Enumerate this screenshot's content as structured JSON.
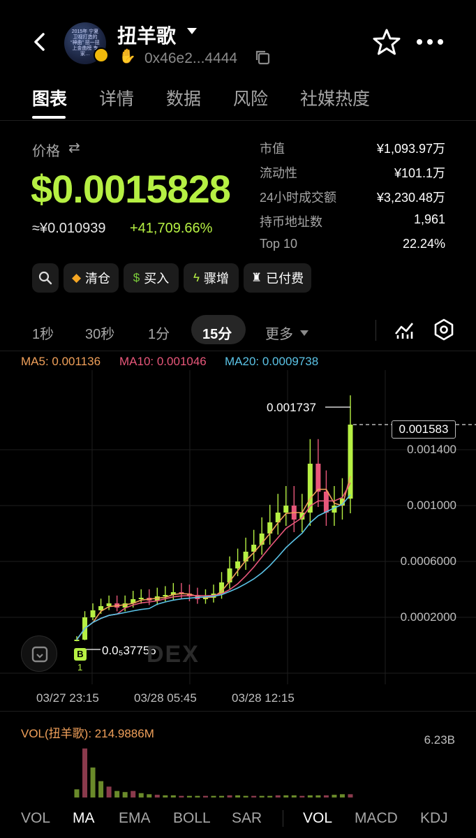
{
  "header": {
    "back_icon": "chevron-left-icon",
    "token_name": "扭羊歌",
    "address": "0x46e2...4444",
    "avatar_text": "2015年 宁夏卫视打造的 “神曲” 扭一扭 上金曲榜 专家…",
    "icons": [
      "caret-down-icon",
      "waving-hand-icon",
      "copy-icon",
      "star-icon",
      "more-icon"
    ]
  },
  "tabs": [
    {
      "label": "图表",
      "active": true
    },
    {
      "label": "详情",
      "active": false
    },
    {
      "label": "数据",
      "active": false
    },
    {
      "label": "风险",
      "active": false
    },
    {
      "label": "社媒热度",
      "active": false
    }
  ],
  "price": {
    "label": "价格",
    "value": "$0.0015828",
    "cny": "≈¥0.010939",
    "change": "+41,709.66%"
  },
  "stats": [
    {
      "label": "市值",
      "value": "¥1,093.97万"
    },
    {
      "label": "流动性",
      "value": "¥101.1万"
    },
    {
      "label": "24小时成交额",
      "value": "¥3,230.48万"
    },
    {
      "label": "持币地址数",
      "value": "1,961"
    },
    {
      "label": "Top 10",
      "value": "22.24%"
    }
  ],
  "actions": [
    {
      "label": "",
      "icon": "search-icon"
    },
    {
      "label": "清仓",
      "icon": "chef-hat-icon"
    },
    {
      "label": "买入",
      "icon": "money-bag-icon"
    },
    {
      "label": "骤增",
      "icon": "lightning-icon"
    },
    {
      "label": "已付费",
      "icon": "eagle-icon"
    }
  ],
  "intervals": [
    {
      "label": "1秒",
      "active": false
    },
    {
      "label": "30秒",
      "active": false
    },
    {
      "label": "1分",
      "active": false
    },
    {
      "label": "15分",
      "active": true
    },
    {
      "label": "更多",
      "active": false
    }
  ],
  "ma": {
    "ma5": "MA5: 0.001136",
    "ma10": "MA10: 0.001046",
    "ma20": "MA20: 0.0009738",
    "colors": {
      "ma5": "#f0a05a",
      "ma10": "#e8577a",
      "ma20": "#5bc3e6"
    }
  },
  "chart_data": {
    "type": "candlestick",
    "y_ticks": [
      "0.001400",
      "0.001000",
      "0.0006000",
      "0.0002000"
    ],
    "x_ticks": [
      "03/27 23:15",
      "03/28 05:45",
      "03/28 12:15"
    ],
    "high_label": "0.001737",
    "low_label": "0.0₅37756",
    "current_price_label": "0.001583",
    "buy_marker": "B",
    "buy_count": "1",
    "watermark": "DEX",
    "series_close": [
      4e-05,
      0.0002,
      0.00025,
      0.00028,
      0.0003,
      0.00027,
      0.0003,
      0.00033,
      0.00034,
      0.00032,
      0.00035,
      0.00036,
      0.00038,
      0.00037,
      0.00035,
      0.00033,
      0.00034,
      0.00037,
      0.00045,
      0.00055,
      0.0006,
      0.00067,
      0.00072,
      0.0008,
      0.00088,
      0.00095,
      0.001,
      0.0009,
      0.00095,
      0.0013,
      0.0011,
      0.00095,
      0.001,
      0.00105,
      0.00158
    ],
    "colors": {
      "up": "#b6f043",
      "down": "#e8577a"
    }
  },
  "volume": {
    "title": "VOL(扭羊歌): 214.9886M",
    "max_label": "6.23B",
    "bars": [
      0.15,
      0.9,
      0.55,
      0.3,
      0.2,
      0.12,
      0.1,
      0.12,
      0.08,
      0.06,
      0.05,
      0.04,
      0.04,
      0.03,
      0.03,
      0.03,
      0.03,
      0.03,
      0.03,
      0.04,
      0.04,
      0.03,
      0.03,
      0.03,
      0.03,
      0.04,
      0.04,
      0.04,
      0.03,
      0.04,
      0.04,
      0.04,
      0.05,
      0.06,
      0.06
    ]
  },
  "indicators": [
    {
      "label": "VOL",
      "active": false
    },
    {
      "label": "MA",
      "active": true
    },
    {
      "label": "EMA",
      "active": false
    },
    {
      "label": "BOLL",
      "active": false
    },
    {
      "label": "SAR",
      "active": false
    },
    {
      "label": "VOL",
      "active": true
    },
    {
      "label": "MACD",
      "active": false
    },
    {
      "label": "KDJ",
      "active": false
    }
  ]
}
